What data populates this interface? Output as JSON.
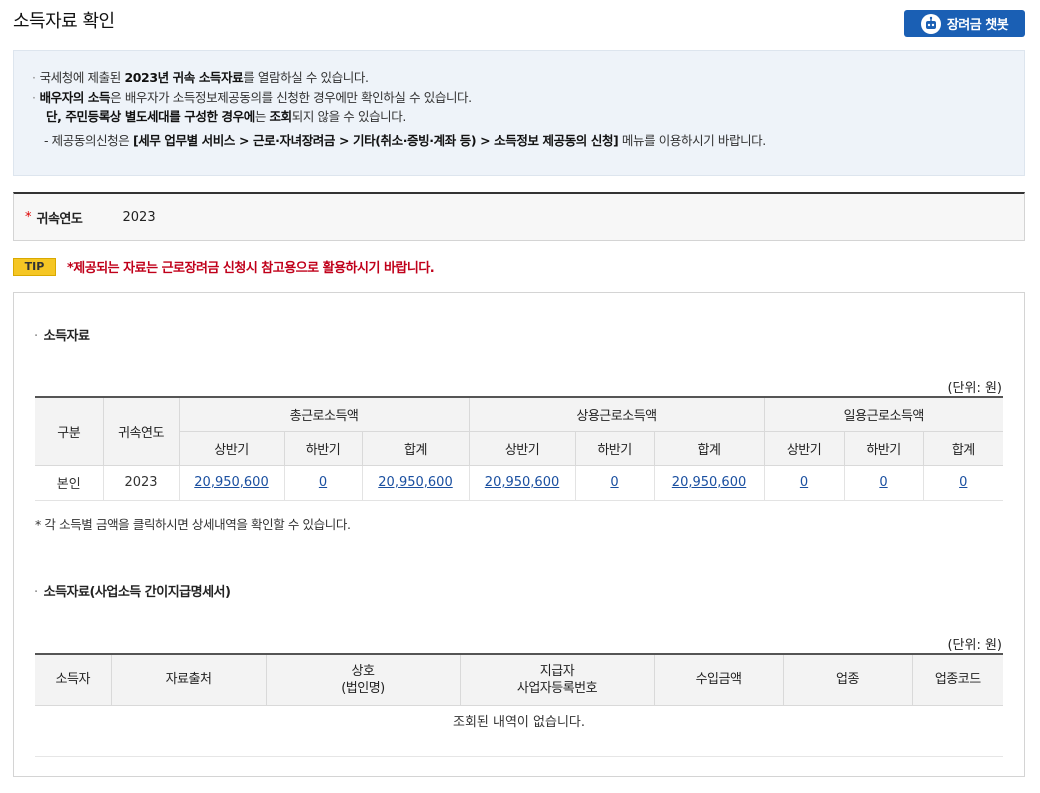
{
  "page": {
    "title": "소득자료 확인",
    "chatbot_label": "장려금 챗봇"
  },
  "notice": {
    "line1_pre": "국세청에 제출된 ",
    "line1_bold": "2023년 귀속 소득자료",
    "line1_post": "를 열람하실 수 있습니다.",
    "line2_bold": "배우자의 소득",
    "line2_post": "은 배우자가 소득정보제공동의를 신청한 경우에만 확인하실 수 있습니다.",
    "line3_bold1": "단, 주민등록상 별도세대를 구성한 경우에",
    "line3_mid": "는 ",
    "line3_bold2": "조회",
    "line3_post": "되지 않을 수 있습니다.",
    "line4_pre": "- 제공동의신청은 ",
    "line4_bold": "[세무 업무별 서비스 > 근로·자녀장려금 > 기타(취소·증빙·계좌 등) > 소득정보 제공동의 신청]",
    "line4_post": " 메뉴를 이용하시기 바랍니다."
  },
  "year_filter": {
    "label": "귀속연도",
    "value": "2023"
  },
  "tip": {
    "badge": "TIP",
    "text": "*제공되는 자료는 근로장려금 신청시 참고용으로 활용하시기 바랍니다."
  },
  "income_section": {
    "title": "소득자료",
    "unit": "(단위: 원)",
    "headers": {
      "category": "구분",
      "year": "귀속연도",
      "total": "총근로소득액",
      "regular": "상용근로소득액",
      "daily": "일용근로소득액",
      "h1": "상반기",
      "h2": "하반기",
      "sum": "합계"
    },
    "row": {
      "category": "본인",
      "year": "2023",
      "total_h1": "20,950,600",
      "total_h2": "0",
      "total_sum": "20,950,600",
      "regular_h1": "20,950,600",
      "regular_h2": "0",
      "regular_sum": "20,950,600",
      "daily_h1": "0",
      "daily_h2": "0",
      "daily_sum": "0"
    },
    "note": "* 각 소득별 금액을 클릭하시면 상세내역을 확인할 수 있습니다."
  },
  "business_section": {
    "title": "소득자료(사업소득 간이지급명세서)",
    "unit": "(단위: 원)",
    "headers": {
      "earner": "소득자",
      "source": "자료출처",
      "company_l1": "상호",
      "company_l2": "(법인명)",
      "payer_l1": "지급자",
      "payer_l2": "사업자등록번호",
      "income": "수입금액",
      "industry": "업종",
      "industry_code": "업종코드"
    },
    "empty_message": "조회된 내역이 없습니다."
  }
}
